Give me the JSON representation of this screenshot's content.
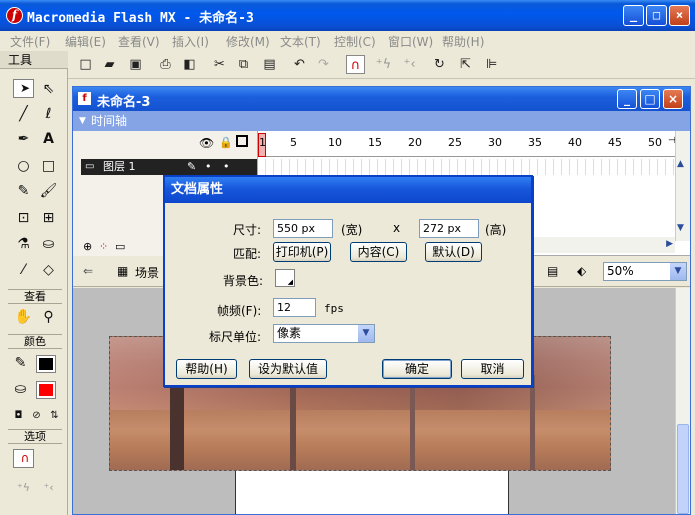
{
  "app": {
    "title": "Macromedia Flash MX - 未命名-3",
    "logo_letter": "f",
    "window_buttons": {
      "minimize": "_",
      "maximize": "□",
      "close": "×"
    }
  },
  "menubar": [
    "文件(F)",
    "编辑(E)",
    "查看(V)",
    "插入(I)",
    "修改(M)",
    "文本(T)",
    "控制(C)",
    "窗口(W)",
    "帮助(H)"
  ],
  "toolbar": {
    "icons": [
      "new-icon",
      "open-icon",
      "save-icon",
      "print-icon",
      "print-preview-icon",
      "cut-icon",
      "copy-icon",
      "paste-icon",
      "undo-icon",
      "redo-icon",
      "snap-magnet-icon",
      "smooth-icon",
      "straighten-icon",
      "rotate-icon",
      "scale-icon",
      "align-icon"
    ]
  },
  "tools_panel": {
    "header": "工具",
    "view_label": "查看",
    "colors_label": "颜色",
    "options_label": "选项",
    "stroke_color": "#000000",
    "fill_color": "#ff0000"
  },
  "document": {
    "title": "未命名-3",
    "timeline_label": "时间轴",
    "layer_name": "图层 1",
    "frame_numbers": [
      "1",
      "5",
      "10",
      "15",
      "20",
      "25",
      "30",
      "35",
      "40",
      "45",
      "50"
    ],
    "scene_label": "场景",
    "zoom": "50%"
  },
  "dialog": {
    "title": "文档属性",
    "size_label": "尺寸:",
    "width_value": "550 px",
    "width_unit": "(宽)",
    "times": "x",
    "height_value": "272 px",
    "height_unit": "(高)",
    "match_label": "匹配:",
    "printer_button": "打印机(P)",
    "contents_button": "内容(C)",
    "default_button": "默认(D)",
    "bg_color_label": "背景色:",
    "bg_color": "#ffffff",
    "frame_rate_label": "帧频(F):",
    "frame_rate_value": "12",
    "fps": "fps",
    "ruler_units_label": "标尺单位:",
    "ruler_units_value": "像素",
    "help_button": "帮助(H)",
    "make_default_button": "设为默认值",
    "ok_button": "确定",
    "cancel_button": "取消"
  }
}
